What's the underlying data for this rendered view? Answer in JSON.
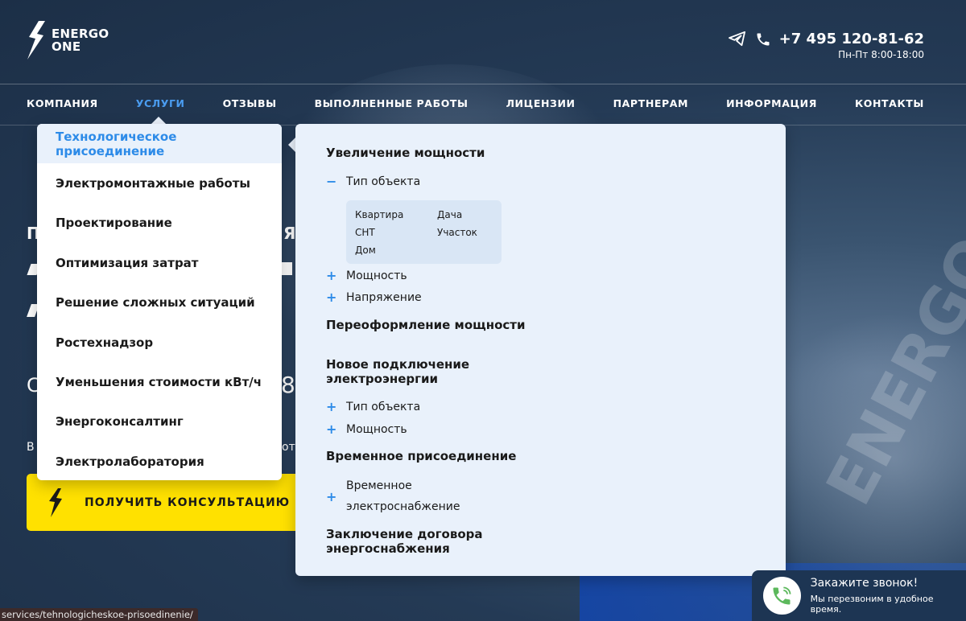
{
  "header": {
    "logo_line1": "ENERGO",
    "logo_line2": "ONE",
    "phone": "+7 495 120-81-62",
    "hours": "Пн-Пт 8:00-18:00"
  },
  "nav": {
    "items": [
      "КОМПАНИЯ",
      "УСЛУГИ",
      "ОТЗЫВЫ",
      "ВЫПОЛНЕННЫЕ РАБОТЫ",
      "ЛИЦЕНЗИИ",
      "ПАРТНЕРАМ",
      "ИНФОРМАЦИЯ",
      "КОНТАКТЫ"
    ],
    "active": "УСЛУГИ"
  },
  "hero": {
    "title_left": "П",
    "title_right": "Я",
    "num_left": "С",
    "num_right": "8",
    "sub_left": "В",
    "sub_right": "от"
  },
  "cta": {
    "label": "ПОЛУЧИТЬ КОНСУЛЬТАЦИЮ"
  },
  "services_menu": {
    "items": [
      "Технологическое присоединение",
      "Электромонтажные работы",
      "Проектирование",
      "Оптимизация затрат",
      "Решение сложных ситуаций",
      "Ростехнадзор",
      "Уменьшения стоимости кВт/ч",
      "Энергоконсалтинг",
      "Электролаборатория"
    ],
    "active_index": 0
  },
  "submenu": {
    "cat1": "Увеличение мощности",
    "cat1_sub1": "Тип объекта",
    "cat1_sub1_sign": "−",
    "cat1_options": [
      "Квартира",
      "Дача",
      "СНТ",
      "Участок",
      "Дом"
    ],
    "cat1_sub2": "Мощность",
    "cat1_sub3": "Напряжение",
    "cat2": "Переоформление мощности",
    "cat3_line1": "Новое подключение",
    "cat3_line2": "электроэнергии",
    "cat3_sub1": "Тип объекта",
    "cat3_sub2": "Мощность",
    "cat4": "Временное присоединение",
    "cat4_sub1_line1": "Временное",
    "cat4_sub1_line2": "электроснабжение",
    "cat5_line1": "Заключение договора",
    "cat5_line2": "энергоснабжения",
    "plus_sign": "+"
  },
  "callback": {
    "title": "Закажите звонок!",
    "subtitle": "Мы перезвоним в удобное время."
  },
  "status_bar": {
    "url": "services/tehnologicheskoe-prisoedinenie/"
  },
  "colors": {
    "accent": "#2d8be8",
    "nav_active": "#4a9cf0",
    "cta": "#ffe100",
    "menu_bg": "#e9f1fb"
  },
  "icons": [
    "lightning-logo-icon",
    "telegram-icon",
    "phone-icon",
    "lightning-icon",
    "phone-call-icon"
  ]
}
